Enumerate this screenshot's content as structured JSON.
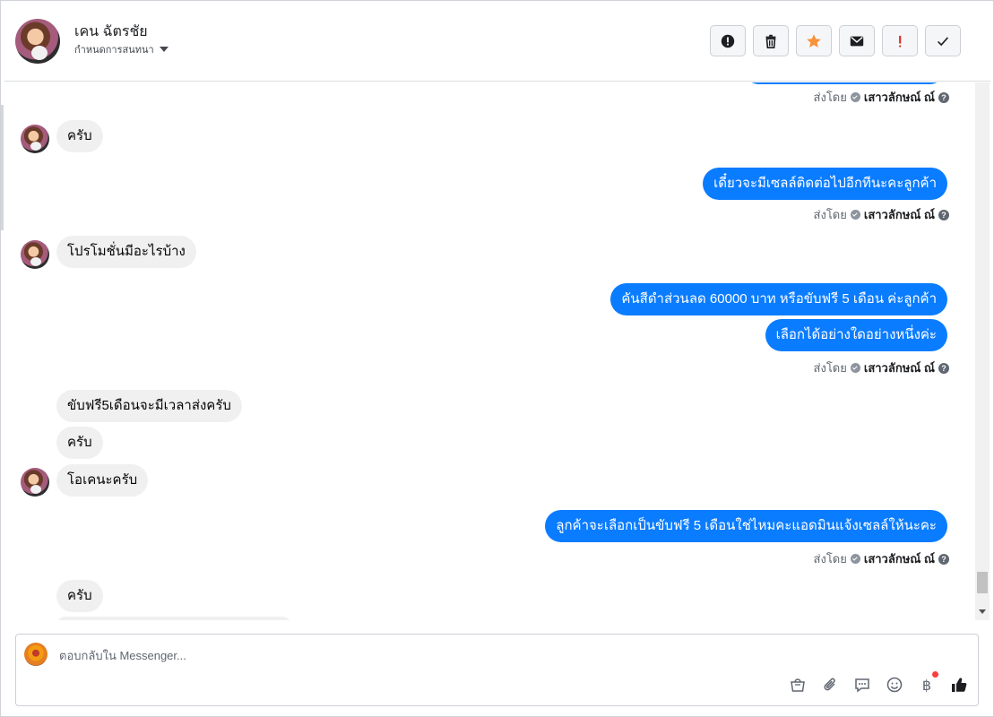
{
  "header": {
    "name": "เคน ฉัตรชัย",
    "subtitle": "กำหนดการสนทนา"
  },
  "actions": [
    {
      "name": "report-icon",
      "glyph": "!",
      "color": "#1c1e21"
    },
    {
      "name": "trash-icon",
      "glyph": "",
      "color": "#1c1e21"
    },
    {
      "name": "star-icon",
      "glyph": "",
      "color": "#f7923b"
    },
    {
      "name": "envelope-icon",
      "glyph": "",
      "color": "#1c1e21"
    },
    {
      "name": "exclamation-icon",
      "glyph": "!",
      "color": "#e02c2c"
    },
    {
      "name": "check-icon",
      "glyph": "",
      "color": "#1c1e21"
    }
  ],
  "sent_by": {
    "prefix": "ส่งโดย",
    "agent": "เสาวลักษณ์ ณ์",
    "help": "?"
  },
  "messages": {
    "m1": "ครับ",
    "m2": "เดี๋ยวจะมีเซลล์ติดต่อไปอีกทีนะคะลูกค้า",
    "m3": "โปรโมชั่นมีอะไรบ้าง",
    "m4": "คันสีดำส่วนลด 60000 บาท หรือขับฟรี 5 เดือน ค่ะลูกค้า",
    "m5": "เลือกได้อย่างใดอย่างหนึ่งค่ะ",
    "m6": "ขับฟรี5เดือนจะมีเวลาส่งครับ",
    "m7": "ครับ",
    "m8": "โอเคนะครับ",
    "m9": "ลูกค้าจะเลือกเป็นขับฟรี 5 เดือนใช่ไหมคะแอดมินแจ้งเซลล์ให้นะคะ",
    "m10": "ครับ"
  },
  "composer": {
    "placeholder": "ตอบกลับใน Messenger...",
    "currency_glyph": "฿"
  },
  "colors": {
    "outgoing_bubble": "#0a7cff",
    "incoming_bubble": "#f0f0f0",
    "star": "#f7923b",
    "alert_red": "#e02c2c"
  }
}
